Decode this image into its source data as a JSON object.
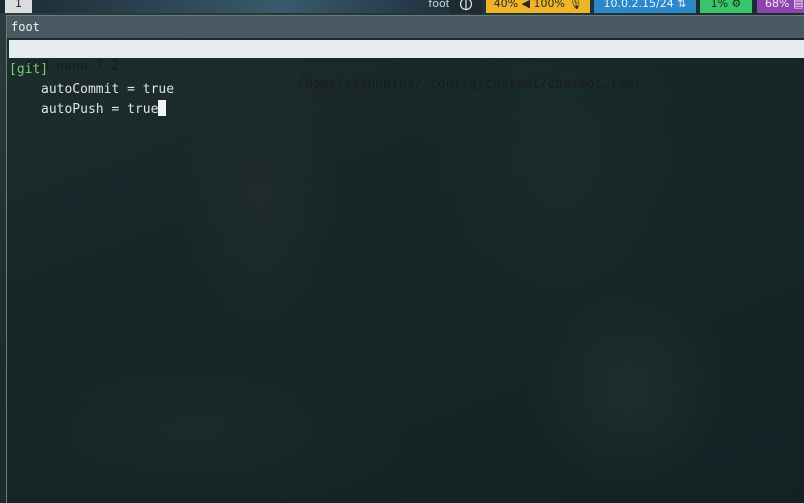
{
  "statusbar": {
    "workspace": "1",
    "active_window": "foot",
    "tray_icon": "pi-icon",
    "audio": "40% ◀ 100% 🎙",
    "network": "10.0.2.15/24 ⇅",
    "cpu": "1% ⚙",
    "memory": "68% ▤",
    "colors": {
      "audio": "#f0b428",
      "network": "#2d88c9",
      "cpu": "#3cc46a",
      "memory": "#8e44ad"
    }
  },
  "window": {
    "title": "foot"
  },
  "nano": {
    "version": "GNU nano 7.2",
    "file_path": "/home/sashubina/.config/chezmoi/chezmoi.toml",
    "lines": [
      "[git]",
      "autoCommit = true",
      "autoPush = true"
    ]
  }
}
